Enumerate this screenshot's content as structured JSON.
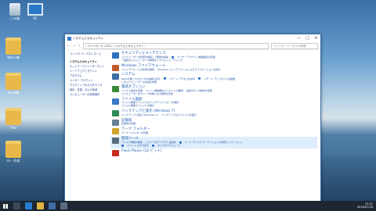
{
  "desktop": {
    "icons": [
      {
        "label": "ごみ箱",
        "type": "recycle"
      },
      {
        "label": "PC",
        "type": "pc"
      },
      {
        "label": "Word 練",
        "type": "folder"
      },
      {
        "label": "Excel練",
        "type": "folder"
      },
      {
        "label": "Files",
        "type": "folder"
      },
      {
        "label": "co - 作成",
        "type": "folder"
      }
    ]
  },
  "window": {
    "title": "システムとセキュリティ",
    "controls": {
      "minimize": "—",
      "maximize": "□",
      "close": "✕"
    },
    "address": {
      "path": "› コントロール パネル › システムとセキュリティ ›",
      "search_placeholder": "コントロール パネルの検索"
    },
    "sidebar": {
      "home": "コントロール パネル ホーム",
      "items": [
        "システムとセキュリティ",
        "ネットワークとインターネット",
        "ハードウェアとサウンド",
        "プログラム",
        "ユーザー アカウント",
        "デスクトップのカスタマイズ",
        "時計、言語、および地域",
        "コンピューターの簡単操作"
      ]
    },
    "categories": [
      {
        "title": "セキュリティとメンテナンス",
        "color": "#2f6fc0",
        "links": [
          "コンピューターの状態を確認して問題を解決",
          "ユーザー アカウント制御設定の変更",
          "一般的なコンピューターの問題のトラブルシューティング"
        ]
      },
      {
        "title": "Windows ファイアウォール",
        "color": "#c0592a",
        "links": [
          "ファイアウォールの状態の確認",
          "Windows ファイアウォールによるアプリケーションの許可"
        ]
      },
      {
        "title": "システム",
        "color": "#3a6ea5",
        "links": [
          "RAM の量とプロセッサの速度の表示",
          "リモート アクセスの許可",
          "リモート アシスタンスの起動",
          "このコンピューターの名前を参照"
        ]
      },
      {
        "title": "電源オプション",
        "color": "#3d8a3a",
        "links": [
          "バッテリ設定の変更",
          "スリープ解除時のパスワードの要求",
          "電源ボタンの動作の変更",
          "コンピューターがスリープ状態になる時間を変更"
        ]
      },
      {
        "title": "ファイル履歴",
        "color": "#3b78c4",
        "links": [
          "ファイル履歴でファイルのバックアップ コピーを保存",
          "ファイル履歴でファイルを復元"
        ]
      },
      {
        "title": "バックアップと復元 (Windows 7)",
        "color": "#2e8b57",
        "links": [
          "バックアップと復元 (Windows 7)",
          "バックアップからファイルを復元"
        ]
      },
      {
        "title": "記憶域",
        "color": "#6a7f95",
        "links": [
          "記憶域の管理"
        ]
      },
      {
        "title": "ワーク フォルダー",
        "color": "#d4a32c",
        "links": [
          "ワーク フォルダーの管理"
        ]
      },
      {
        "title": "管理ツール",
        "color": "#5a6b7d",
        "links": [
          "ディスク領域の解放",
          "ドライブのデフラグと最適化",
          "ハード ディスク パーティションの作成とフォーマット",
          "イベント ログの表示",
          "タスクのスケジュール"
        ]
      },
      {
        "title": "Flash Player (32 ビット)",
        "color": "#c62a1e",
        "links": []
      }
    ]
  },
  "taskbar": {
    "time": "15:21",
    "date": "2016/07/16"
  }
}
